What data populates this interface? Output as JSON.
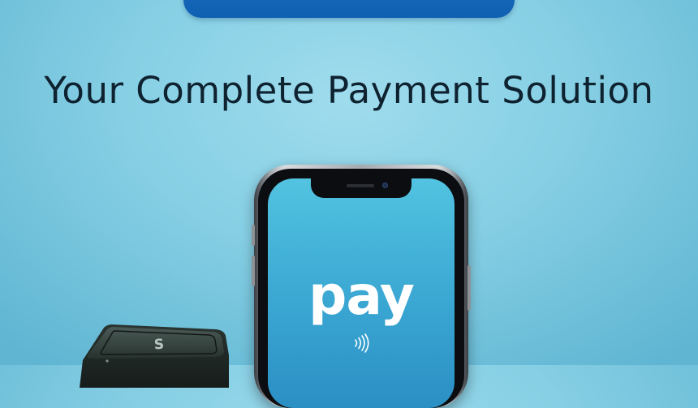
{
  "headline": "Your Complete Payment Solution",
  "phone_screen": {
    "wordmark": "pay",
    "contactless_icon": "contactless-icon"
  },
  "reader": {
    "logo": "S",
    "icon": "card-reader-icon"
  },
  "colors": {
    "background": "#86cfe4",
    "banner": "#1565bb",
    "screen": "#3aa6d2",
    "headline_text": "#0e2230"
  }
}
